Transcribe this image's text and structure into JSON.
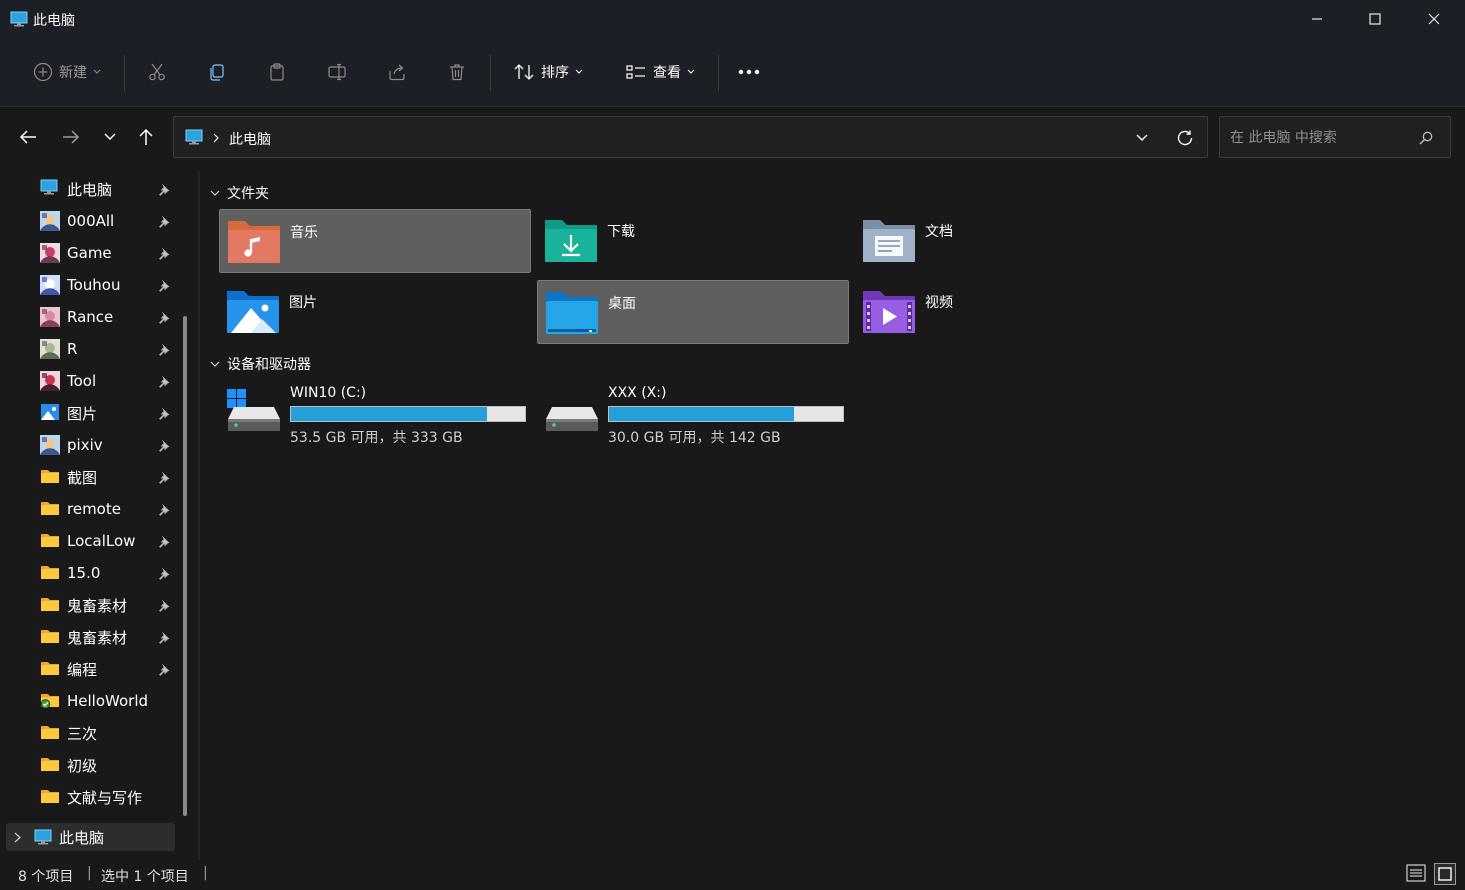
{
  "window": {
    "title": "此电脑"
  },
  "toolbar": {
    "new_label": "新建",
    "sort_label": "排序",
    "view_label": "查看"
  },
  "address": {
    "location": "此电脑"
  },
  "search": {
    "placeholder": "在 此电脑 中搜索"
  },
  "sidebar": {
    "items": [
      {
        "label": "此电脑",
        "icon": "pc-icon",
        "pinned": true
      },
      {
        "label": "000All",
        "icon": "image-thumb-icon",
        "pinned": true
      },
      {
        "label": "Game",
        "icon": "image-thumb-icon",
        "pinned": true
      },
      {
        "label": "Touhou",
        "icon": "image-thumb-icon",
        "pinned": true
      },
      {
        "label": "Rance",
        "icon": "image-thumb-icon",
        "pinned": true
      },
      {
        "label": "R",
        "icon": "image-thumb-icon",
        "pinned": true
      },
      {
        "label": "Tool",
        "icon": "image-thumb-icon",
        "pinned": true
      },
      {
        "label": "图片",
        "icon": "pictures-icon",
        "pinned": true
      },
      {
        "label": "pixiv",
        "icon": "image-thumb-icon",
        "pinned": true
      },
      {
        "label": "截图",
        "icon": "folder-icon",
        "pinned": true
      },
      {
        "label": "remote",
        "icon": "folder-icon",
        "pinned": true
      },
      {
        "label": "LocalLow",
        "icon": "folder-icon",
        "pinned": true
      },
      {
        "label": "15.0",
        "icon": "folder-icon",
        "pinned": true
      },
      {
        "label": "鬼畜素材",
        "icon": "folder-icon",
        "pinned": true
      },
      {
        "label": "鬼畜素材",
        "icon": "folder-icon",
        "pinned": true
      },
      {
        "label": "编程",
        "icon": "folder-icon",
        "pinned": true
      },
      {
        "label": "HelloWorld",
        "icon": "folder-synced-icon",
        "pinned": false
      },
      {
        "label": "三次",
        "icon": "folder-icon",
        "pinned": false
      },
      {
        "label": "初级",
        "icon": "folder-icon",
        "pinned": false
      },
      {
        "label": "文献与写作",
        "icon": "folder-icon",
        "pinned": false
      }
    ],
    "root_label": "此电脑"
  },
  "content": {
    "folders_header": "文件夹",
    "drives_header": "设备和驱动器",
    "folders": [
      {
        "label": "音乐",
        "icon": "music-folder-icon",
        "state": "selected"
      },
      {
        "label": "下载",
        "icon": "downloads-folder-icon",
        "state": "normal"
      },
      {
        "label": "文档",
        "icon": "documents-folder-icon",
        "state": "normal"
      },
      {
        "label": "图片",
        "icon": "pictures-folder-icon",
        "state": "normal"
      },
      {
        "label": "桌面",
        "icon": "desktop-folder-icon",
        "state": "selected"
      },
      {
        "label": "视频",
        "icon": "videos-folder-icon",
        "state": "normal"
      }
    ],
    "drives": [
      {
        "name": "WIN10 (C:)",
        "free_text": "53.5 GB 可用，共 333 GB",
        "used_fraction": 0.839
      },
      {
        "name": "XXX (X:)",
        "free_text": "30.0 GB 可用，共 142 GB",
        "used_fraction": 0.789
      }
    ]
  },
  "status": {
    "item_count": "8 个项目",
    "selected": "选中 1 个项目"
  },
  "colors": {
    "accent": "#26a0da",
    "background": "#191919",
    "chrome": "#1c1f26"
  }
}
